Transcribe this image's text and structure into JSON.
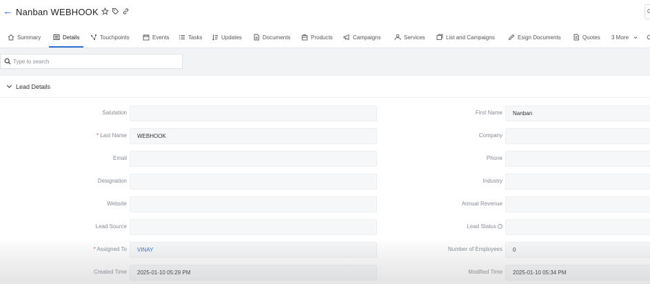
{
  "header": {
    "back_icon": "arrow-left-icon",
    "title": "Nanban WEBHOOK",
    "icons": [
      "star-icon",
      "tag-icon",
      "link-icon"
    ],
    "right_button_label": "C"
  },
  "tabs": [
    {
      "label": "Summary",
      "icon": "home-icon"
    },
    {
      "label": "Details",
      "icon": "details-icon",
      "active": true
    },
    {
      "label": "Touchpoints",
      "icon": "touchpoints-icon"
    },
    {
      "label": "Events",
      "icon": "calendar-icon"
    },
    {
      "label": "Tasks",
      "icon": "tasks-icon"
    },
    {
      "label": "Updates",
      "icon": "updates-icon"
    },
    {
      "label": "Documents",
      "icon": "document-icon"
    },
    {
      "label": "Products",
      "icon": "products-icon"
    },
    {
      "label": "Campaigns",
      "icon": "megaphone-icon"
    },
    {
      "label": "Services",
      "icon": "services-icon"
    },
    {
      "label": "List and Campaigns",
      "icon": "list-icon"
    },
    {
      "label": "Esign Documents",
      "icon": "pen-icon"
    },
    {
      "label": "Quotes",
      "icon": "quote-icon"
    },
    {
      "label": "3 More",
      "icon": "chevron-down-icon"
    }
  ],
  "search": {
    "placeholder": "Type to search"
  },
  "section": {
    "title": "Lead Details"
  },
  "fields": {
    "salutation": {
      "label": "Salutation",
      "value": ""
    },
    "first_name": {
      "label": "First Name",
      "value": "Nanban"
    },
    "last_name": {
      "label": "Last Name",
      "value": "WEBHOOK",
      "required": "*"
    },
    "company": {
      "label": "Company",
      "value": ""
    },
    "email": {
      "label": "Email",
      "value": ""
    },
    "phone": {
      "label": "Phone",
      "value": ""
    },
    "designation": {
      "label": "Designation",
      "value": ""
    },
    "industry": {
      "label": "Industry",
      "value": ""
    },
    "website": {
      "label": "Website",
      "value": ""
    },
    "annual_revenue": {
      "label": "Annual Revenue",
      "value": ""
    },
    "lead_source": {
      "label": "Lead Source",
      "value": ""
    },
    "lead_status": {
      "label": "Lead Status",
      "value": ""
    },
    "assigned_to": {
      "label": "Assigned To",
      "value": "VINAY",
      "required": "*"
    },
    "number_of_employees": {
      "label": "Number of Employees",
      "value": "0"
    },
    "created_time": {
      "label": "Created Time",
      "value": "2025-01-10 05:29 PM"
    },
    "modified_time": {
      "label": "Modified Time",
      "value": "2025-01-10 05:34 PM"
    }
  },
  "colors": {
    "accent": "#2a6fd6",
    "required": "#e5484d"
  }
}
